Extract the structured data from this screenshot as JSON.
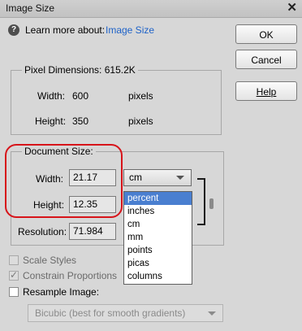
{
  "window": {
    "title": "Image Size",
    "close_glyph": "✕"
  },
  "help": {
    "learn_text": "Learn more about:",
    "link_text": "Image Size"
  },
  "buttons": {
    "ok": "OK",
    "cancel": "Cancel",
    "help": "Help"
  },
  "pixel_dimensions": {
    "title": "Pixel Dimensions:",
    "size": "615.2K",
    "width": {
      "label": "Width:",
      "value": "600",
      "unit": "pixels"
    },
    "height": {
      "label": "Height:",
      "value": "350",
      "unit": "pixels"
    }
  },
  "document_size": {
    "title": "Document Size:",
    "width": {
      "label": "Width:",
      "value": "21.17"
    },
    "height": {
      "label": "Height:",
      "value": "12.35"
    },
    "resolution": {
      "label": "Resolution:",
      "value": "71.984"
    },
    "unit_select": {
      "selected": "cm"
    }
  },
  "unit_dropdown": {
    "options": [
      "percent",
      "inches",
      "cm",
      "mm",
      "points",
      "picas",
      "columns"
    ],
    "highlighted": "percent"
  },
  "checkboxes": {
    "scale_styles": {
      "label": "Scale Styles",
      "checked": false,
      "disabled": true
    },
    "constrain": {
      "label": "Constrain Proportions",
      "checked": true,
      "disabled": true
    },
    "resample": {
      "label": "Resample Image:",
      "checked": false,
      "disabled": false
    }
  },
  "resample_method": {
    "selected": "Bicubic (best for smooth gradients)"
  },
  "colors": {
    "link": "#1e62c8",
    "highlight": "#4a7fd0",
    "annotation": "#d7141a"
  },
  "icons": {
    "help": "question-circle-icon",
    "close": "close-icon",
    "dropdown": "chevron-down-icon",
    "chain": "chain-link-icon"
  }
}
